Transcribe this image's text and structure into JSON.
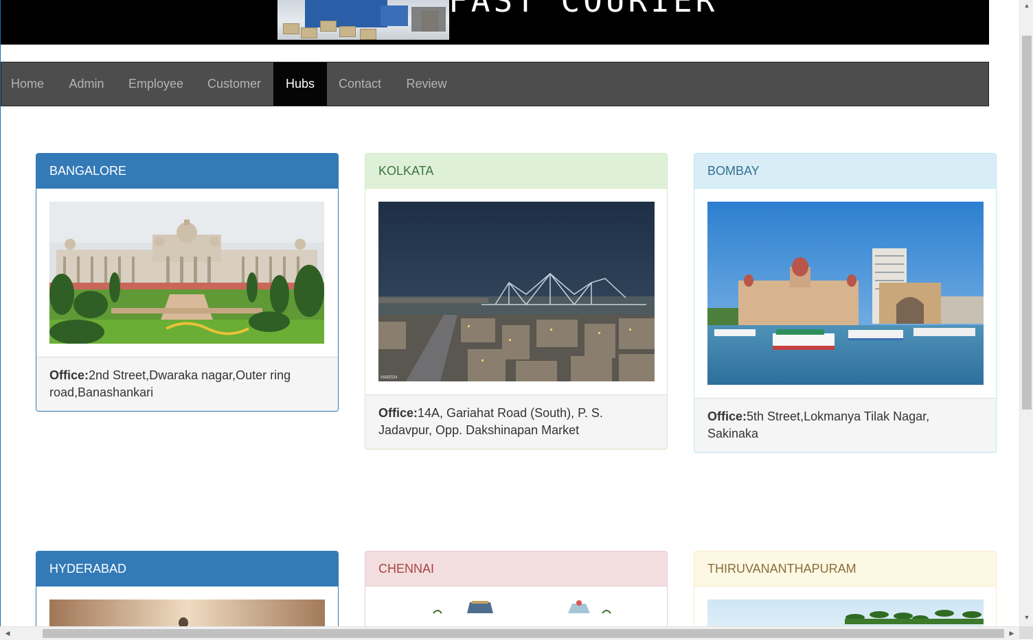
{
  "banner": {
    "title": "FAST COURIER",
    "image_icon": "warehouse-truck-photo"
  },
  "nav": {
    "items": [
      {
        "label": "Home"
      },
      {
        "label": "Admin"
      },
      {
        "label": "Employee"
      },
      {
        "label": "Customer"
      },
      {
        "label": "Hubs"
      },
      {
        "label": "Contact"
      },
      {
        "label": "Review"
      }
    ],
    "active": "Hubs"
  },
  "hubs": [
    {
      "city": "BANGALORE",
      "style": "primary",
      "office_label": "Office:",
      "office": "2nd Street,Dwaraka nagar,Outer ring road,Banashankari",
      "image": "vidhana-soudha-photo"
    },
    {
      "city": "KOLKATA",
      "style": "success",
      "office_label": "Office:",
      "office": "14A, Gariahat Road (South), P. S. Jadavpur, Opp. Dakshinapan Market",
      "image": "howrah-bridge-photo",
      "watermark": "HARSH"
    },
    {
      "city": "BOMBAY",
      "style": "info",
      "office_label": "Office:",
      "office": "5th Street,Lokmanya Tilak Nagar, Sakinaka",
      "image": "gateway-of-india-photo"
    },
    {
      "city": "HYDERABAD",
      "style": "primary",
      "image": "charminar-photo"
    },
    {
      "city": "CHENNAI",
      "style": "danger",
      "image": "temple-gopuram-photo"
    },
    {
      "city": "THIRUVANANTHAPURAM",
      "style": "warning",
      "image": "palm-beach-photo"
    }
  ],
  "colors": {
    "primary": "#337ab7",
    "navbar": "#4d4d4d",
    "nav_active": "#050505"
  },
  "scrollbars": {
    "up_icon": "scroll-up-arrow-icon",
    "down_icon": "scroll-down-arrow-icon",
    "left_icon": "scroll-left-arrow-icon",
    "right_icon": "scroll-right-arrow-icon"
  }
}
